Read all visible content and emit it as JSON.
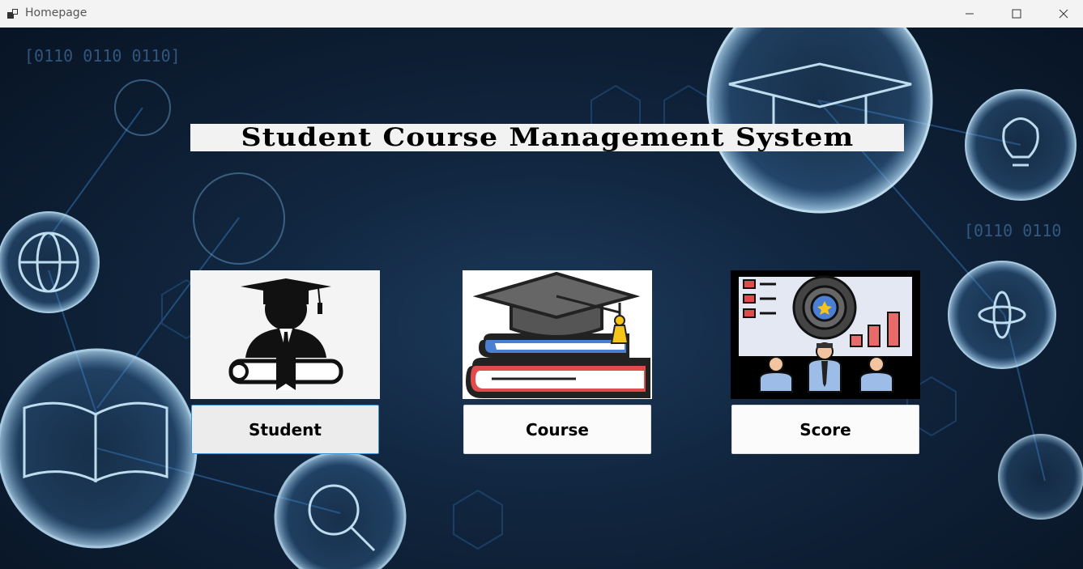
{
  "window": {
    "title": "Homepage"
  },
  "titlebar": {
    "icons": [
      "app-icon",
      "minimize-icon",
      "maximize-icon",
      "close-icon"
    ]
  },
  "background": {
    "binary_text_1": "[0110 0110 0110]",
    "binary_text_2": "[0110 0110"
  },
  "main": {
    "heading": "Student Course Management System",
    "cards": [
      {
        "label": "Student",
        "icon": "graduate-student-icon"
      },
      {
        "label": "Course",
        "icon": "books-graduation-cap-icon"
      },
      {
        "label": "Score",
        "icon": "presentation-score-icon"
      }
    ]
  },
  "colors": {
    "titlebar_bg": "#f3f3f3",
    "background": "#11263f",
    "glow": "#6ec6ff",
    "button_bg": "#fbfbfb",
    "focus_border": "#3c94d4"
  }
}
